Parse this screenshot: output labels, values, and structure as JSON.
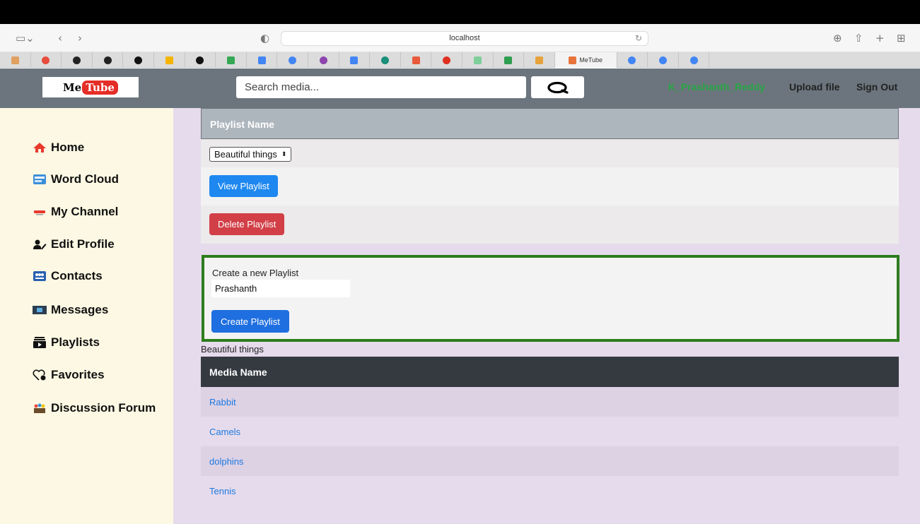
{
  "browser": {
    "address": "localhost",
    "active_tab_title": "MeTube"
  },
  "header": {
    "logo": {
      "part1": "Me",
      "part2": "Tube"
    },
    "search_placeholder": "Search media...",
    "username": "K_Prashanth_Reddy",
    "upload_label": "Upload file",
    "signout_label": "Sign Out"
  },
  "sidebar": {
    "items": [
      {
        "label": "Home",
        "icon": "home-icon"
      },
      {
        "label": "Word Cloud",
        "icon": "word-cloud-icon"
      },
      {
        "label": "My Channel",
        "icon": "channel-icon"
      },
      {
        "label": "Edit Profile",
        "icon": "edit-profile-icon"
      },
      {
        "label": "Contacts",
        "icon": "contacts-icon"
      },
      {
        "label": "Messages",
        "icon": "messages-icon"
      },
      {
        "label": "Playlists",
        "icon": "playlists-icon"
      },
      {
        "label": "Favorites",
        "icon": "favorites-icon"
      },
      {
        "label": "Discussion Forum",
        "icon": "forum-icon"
      }
    ]
  },
  "playlist": {
    "header": "Playlist Name",
    "selected": "Beautiful things",
    "view_label": "View Playlist",
    "delete_label": "Delete Playlist"
  },
  "create": {
    "label": "Create a new Playlist",
    "input_value": "Prashanth",
    "button_label": "Create Playlist"
  },
  "media": {
    "playlist_title": "Beautiful things",
    "header": "Media Name",
    "rows": [
      "Rabbit",
      "Camels",
      "dolphins",
      "Tennis"
    ]
  }
}
